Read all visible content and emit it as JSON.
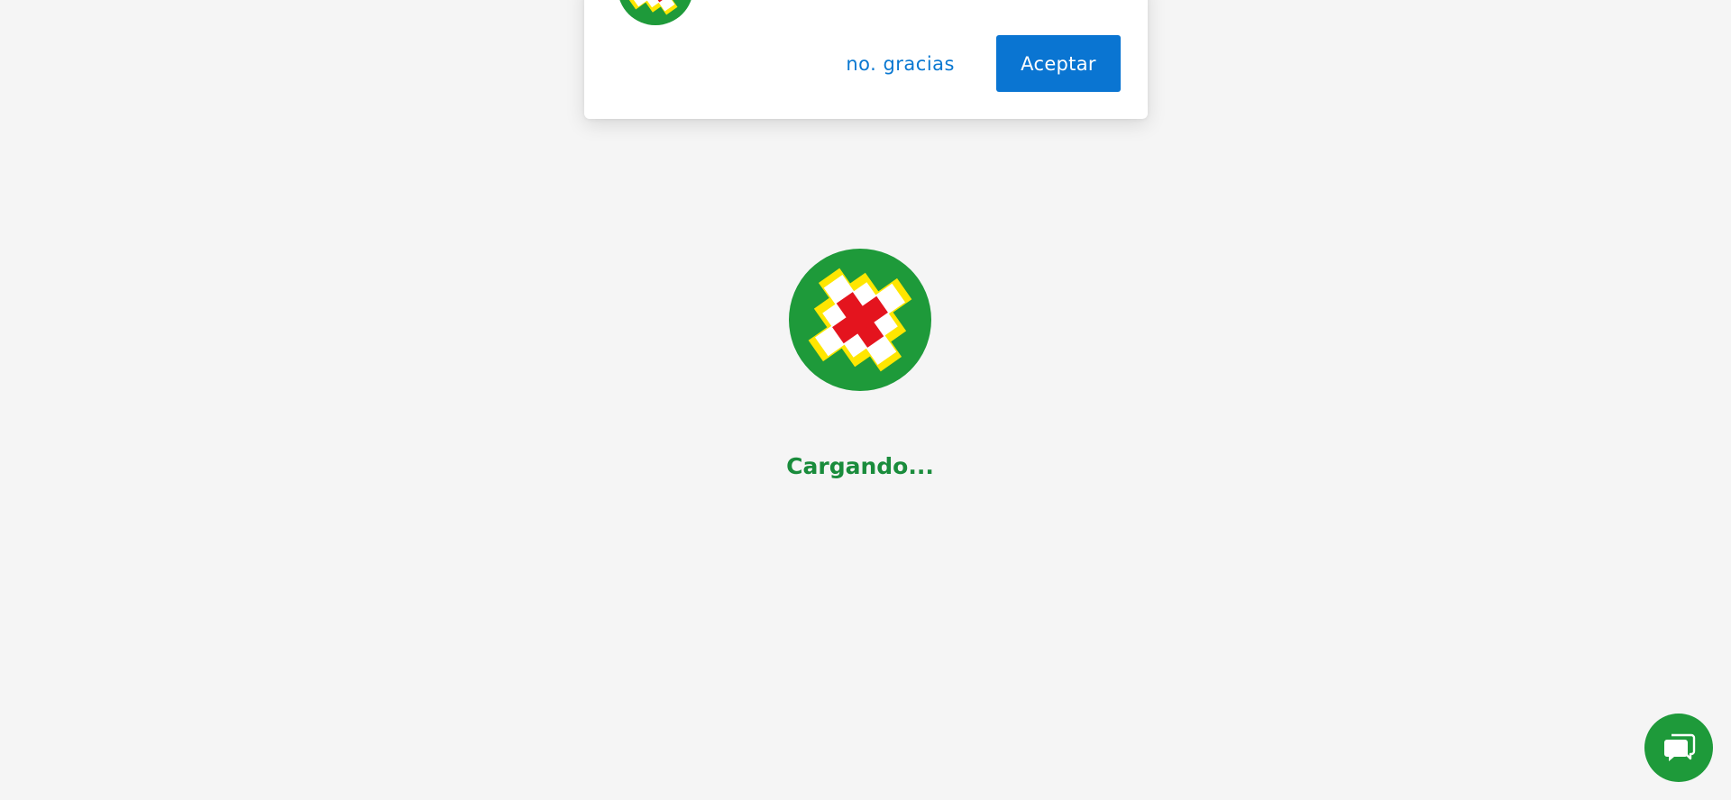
{
  "notification_prompt": {
    "decline_label": "no. gracias",
    "accept_label": "Aceptar"
  },
  "loader": {
    "text": "Cargando..."
  },
  "icons": {
    "prompt_logo": "pharmacy-cross-logo-icon",
    "loader_logo": "pharmacy-cross-logo-icon",
    "chat": "chat-bubbles-icon"
  },
  "colors": {
    "background": "#f5f5f5",
    "brand_green": "#1e9a3a",
    "brand_yellow": "#ffe600",
    "brand_red": "#e4141e",
    "accept_blue": "#0a75d2",
    "decline_text_blue": "#0a78d1",
    "loading_text_green": "#1a8c3c"
  }
}
